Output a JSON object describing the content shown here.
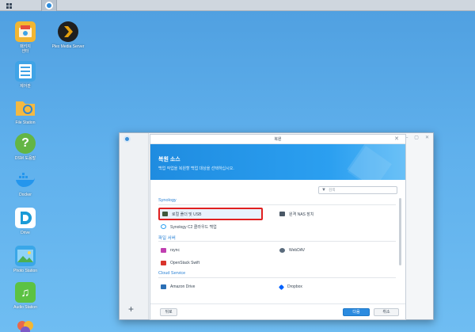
{
  "colors": {
    "desktop": "#5fb0ec",
    "accent": "#2b8be0",
    "section": "#2a82d6",
    "highlight_border": "#e02020"
  },
  "taskbar": {
    "main_menu_icon": "grid-icon",
    "open_app_icon": "hyper-backup-icon"
  },
  "desktop_icons": [
    {
      "label": "패키지\n센터",
      "icon": "package-center-icon",
      "color": "#f2b632"
    },
    {
      "label": "제어판",
      "icon": "control-panel-icon",
      "color": "#3fa3e6"
    },
    {
      "label": "File Station",
      "icon": "folder-icon",
      "color": "#f4b942"
    },
    {
      "label": "DSM 도움말",
      "icon": "help-icon",
      "color": "#63b545"
    },
    {
      "label": "Docker",
      "icon": "docker-icon",
      "color": "#2496ed"
    },
    {
      "label": "Drive",
      "icon": "drive-icon",
      "color": "#1a9bd7"
    },
    {
      "label": "Photo Station",
      "icon": "photo-station-icon",
      "color": "#3aa7e8"
    },
    {
      "label": "Audio Station",
      "icon": "audio-station-icon",
      "color": "#5cc243"
    },
    {
      "label": "",
      "icon": "moments-icon",
      "color": "#e8684a"
    }
  ],
  "plex": {
    "label": "Plex Media Server",
    "icon": "plex-icon"
  },
  "window": {
    "title": "복원",
    "controls": [
      "?",
      "—",
      "▢",
      "✕"
    ]
  },
  "dialog": {
    "banner_title": "복원 소스",
    "banner_subtitle": "백업 작업을 복원할 백업 대상을 선택하십시오.",
    "search_placeholder": "검색",
    "sections": [
      {
        "title": "Synology",
        "options": [
          {
            "label": "로컬 폴더 및 USB",
            "icon": "local-folder-usb-icon",
            "selected": true
          },
          {
            "label": "원격 NAS 장치",
            "icon": "remote-nas-icon",
            "selected": false
          },
          {
            "label": "Synology C2 클라우드 백업",
            "icon": "synology-c2-icon",
            "selected": false
          }
        ]
      },
      {
        "title": "파일 서버",
        "options": [
          {
            "label": "rsync",
            "icon": "rsync-icon",
            "selected": false
          },
          {
            "label": "WebDAV",
            "icon": "webdav-icon",
            "selected": false
          },
          {
            "label": "OpenStack Swift",
            "icon": "openstack-icon",
            "selected": false
          }
        ]
      },
      {
        "title": "Cloud Service",
        "options": [
          {
            "label": "Amazon Drive",
            "icon": "amazon-drive-icon",
            "selected": false
          },
          {
            "label": "Dropbox",
            "icon": "dropbox-icon",
            "selected": false
          }
        ]
      }
    ],
    "buttons": {
      "back": "뒤로",
      "next": "다음",
      "cancel": "취소"
    }
  }
}
